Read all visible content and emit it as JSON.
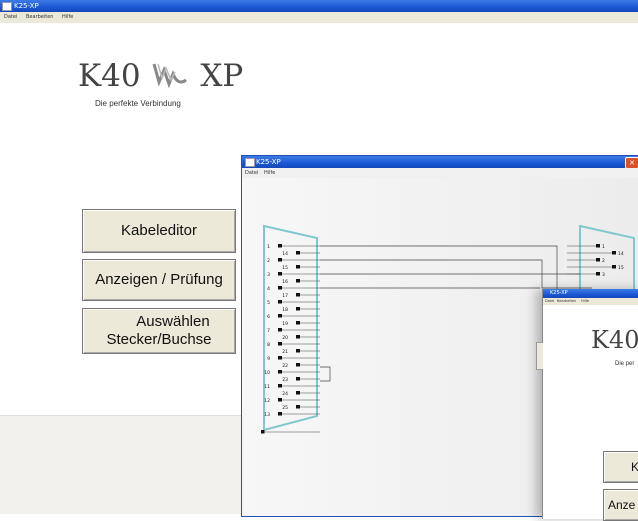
{
  "main_window": {
    "title": "K25-XP",
    "menu": [
      "Datei",
      "Bearbeiten",
      "Hilfe"
    ],
    "logo": {
      "left": "K40",
      "right": "XP"
    },
    "tagline": "Die perfekte Verbindung",
    "buttons": {
      "kabeleditor": "Kabeleditor",
      "anzeigen": "Anzeigen / Prüfung",
      "auswaehlen_line1": "Auswählen",
      "auswaehlen_line2": "Stecker/Buchse"
    }
  },
  "second_window": {
    "title": "K25-XP",
    "menu": [
      "Datei",
      "Hilfe"
    ],
    "close_label": "✕",
    "left_connector_pins": [
      "1",
      "14",
      "2",
      "15",
      "3",
      "16",
      "4",
      "17",
      "5",
      "18",
      "6",
      "19",
      "7",
      "20",
      "8",
      "21",
      "9",
      "22",
      "10",
      "23",
      "11",
      "24",
      "12",
      "25",
      "13"
    ],
    "right_connector_pins": [
      "1",
      "14",
      "2",
      "15",
      "3"
    ]
  },
  "third_window": {
    "title": "K25-XP",
    "menu": [
      "Datei",
      "Bearbeiten",
      "Hilfe"
    ],
    "logo_partial": "K40",
    "tagline_partial": "Die per",
    "button_partial_1": "K",
    "button_partial_2": "Anze"
  }
}
